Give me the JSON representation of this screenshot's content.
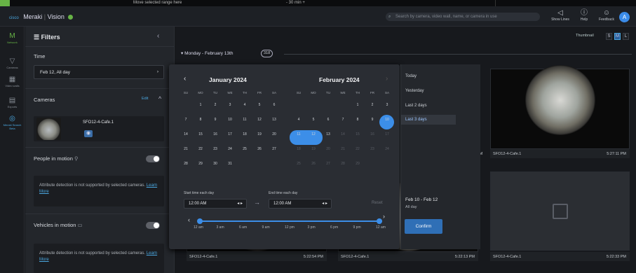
{
  "topstrip": {
    "hint": "Move selected range here",
    "mins": "-   30 min   +"
  },
  "header": {
    "cisco": "cisco",
    "app": "Meraki",
    "product": "Vision",
    "search_placeholder": "Search by camera, video wall, name, or camera in use",
    "buttons": [
      {
        "label": "Show Lines",
        "icon": "monitor-icon"
      },
      {
        "label": "Help",
        "icon": "help-icon"
      },
      {
        "label": "Feedback",
        "icon": "feedback-icon"
      }
    ],
    "avatar": "A"
  },
  "rail": [
    {
      "label": "Network",
      "icon": "meraki-icon"
    },
    {
      "label": "Cameras",
      "icon": "camera-icon"
    },
    {
      "label": "Video walls",
      "icon": "grid-icon"
    },
    {
      "label": "Exports",
      "icon": "export-icon"
    },
    {
      "label": "Meraki Search Beta",
      "icon": "search-icon"
    }
  ],
  "filters": {
    "title": "Filters",
    "time_label": "Time",
    "time_value": "Feb 12, All day",
    "cameras_label": "Cameras",
    "edit": "Edit",
    "camera_name": "SFO12-4-Cafe.1",
    "people_label": "People in motion",
    "vehicles_label": "Vehicles in motion",
    "note_text": "Attribute detection is not supported by selected cameras.",
    "note_link": "Learn More"
  },
  "main": {
    "thumbnail_label": "Thumbnail",
    "sizes": [
      "S",
      "M",
      "L"
    ],
    "day_header": "Monday - February 13th",
    "day_count": "318",
    "tiles": [
      {
        "name": "SFO12-4-Cafe.1",
        "time": "5:27:11 PM"
      },
      {
        "name": "SFO12-4-Cafe.1",
        "time": "5:22:54 PM"
      },
      {
        "name": "SFO12-4-Cafe.1",
        "time": "5:22:13 PM"
      },
      {
        "name": "SFO12-4-Cafe.1",
        "time": "5:22:33 PM"
      }
    ],
    "partial_time": "PM"
  },
  "calendar": {
    "months": [
      "January 2024",
      "February 2024"
    ],
    "dows": [
      "SU",
      "MO",
      "TU",
      "WE",
      "TH",
      "FR",
      "SA"
    ],
    "jan": [
      [
        "",
        "1",
        "2",
        "3",
        "4",
        "5",
        "6"
      ],
      [
        "7",
        "8",
        "9",
        "10",
        "11",
        "12",
        "13"
      ],
      [
        "14",
        "15",
        "16",
        "17",
        "18",
        "19",
        "20"
      ],
      [
        "21",
        "22",
        "23",
        "24",
        "25",
        "26",
        "27"
      ],
      [
        "28",
        "29",
        "30",
        "31",
        "",
        "",
        ""
      ]
    ],
    "feb": [
      [
        "",
        "",
        "",
        "",
        "1",
        "2",
        "3"
      ],
      [
        "4",
        "5",
        "6",
        "7",
        "8",
        "9",
        "10"
      ],
      [
        "11",
        "12",
        "13",
        "14",
        "15",
        "16",
        "17"
      ],
      [
        "18",
        "19",
        "20",
        "21",
        "22",
        "23",
        "24"
      ],
      [
        "25",
        "26",
        "27",
        "28",
        "29",
        "",
        ""
      ]
    ],
    "quick": [
      "Today",
      "Yesterday",
      "Last 2 days",
      "Last 3 days"
    ],
    "quick_selected": "Last 3 days",
    "start_label": "Start time each day",
    "start_value": "12:00 AM",
    "end_label": "End time each day",
    "end_value": "12:00 AM",
    "reset": "Reset",
    "ticks": [
      "12 am",
      "3 am",
      "6 am",
      "9 am",
      "12 pm",
      "3 pm",
      "6 pm",
      "9 pm",
      "12 am"
    ],
    "range_text": "Feb 10 - Feb 12",
    "range_sub": "All day",
    "confirm": "Confirm"
  },
  "colors": {
    "accent": "#3c8ee8",
    "brand_green": "#67b346"
  }
}
